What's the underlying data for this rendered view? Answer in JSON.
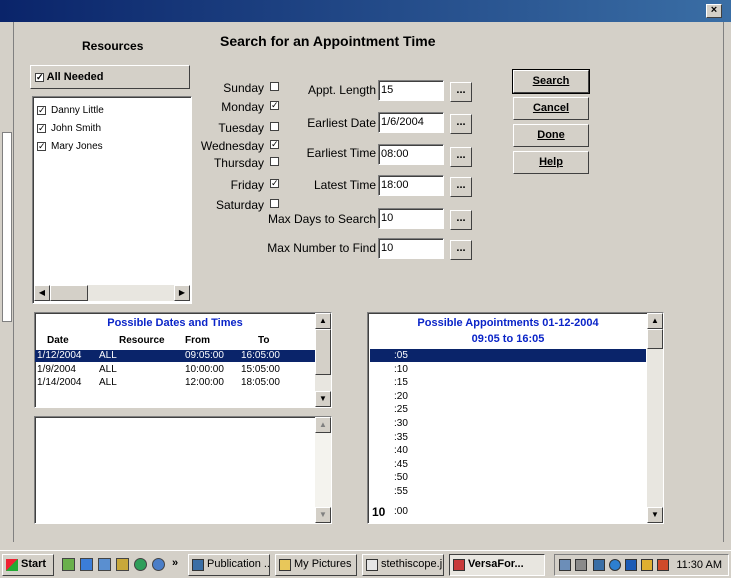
{
  "window": {
    "close_label": "×"
  },
  "resources": {
    "heading": "Resources",
    "all_needed": {
      "label": "All Needed",
      "checked": true
    },
    "items": [
      {
        "label": "Danny Little",
        "checked": true
      },
      {
        "label": "John Smith",
        "checked": true
      },
      {
        "label": "Mary Jones",
        "checked": true
      }
    ]
  },
  "dialog": {
    "title": "Search for an Appointment Time"
  },
  "days": [
    {
      "label": "Sunday",
      "checked": false
    },
    {
      "label": "Monday",
      "checked": true
    },
    {
      "label": "Tuesday",
      "checked": false
    },
    {
      "label": "Wednesday",
      "checked": true
    },
    {
      "label": "Thursday",
      "checked": false
    },
    {
      "label": "Friday",
      "checked": true
    },
    {
      "label": "Saturday",
      "checked": false
    }
  ],
  "fields": {
    "appt_length": {
      "label": "Appt. Length",
      "value": "15"
    },
    "earliest_date": {
      "label": "Earliest Date",
      "value": "1/6/2004"
    },
    "earliest_time": {
      "label": "Earliest Time",
      "value": "08:00"
    },
    "latest_time": {
      "label": "Latest Time",
      "value": "18:00"
    },
    "max_days": {
      "label": "Max Days to Search",
      "value": "10"
    },
    "max_number": {
      "label": "Max Number to Find",
      "value": "10"
    },
    "ellipsis": "..."
  },
  "buttons": {
    "search": "Search",
    "cancel": "Cancel",
    "done": "Done",
    "help": "Help"
  },
  "dates_panel": {
    "title": "Possible Dates and Times",
    "columns": {
      "date": "Date",
      "resource": "Resource",
      "from": "From",
      "to": "To"
    },
    "rows": [
      {
        "date": "1/12/2004",
        "resource": "ALL",
        "from": "09:05:00",
        "to": "16:05:00",
        "selected": true
      },
      {
        "date": "1/9/2004",
        "resource": "ALL",
        "from": "10:00:00",
        "to": "15:05:00",
        "selected": false
      },
      {
        "date": "1/14/2004",
        "resource": "ALL",
        "from": "12:00:00",
        "to": "18:05:00",
        "selected": false
      }
    ]
  },
  "appointments_panel": {
    "title": "Possible Appointments  01-12-2004",
    "subtitle": "09:05 to 16:05",
    "slots": [
      ":05",
      ":10",
      ":15",
      ":20",
      ":25",
      ":30",
      ":35",
      ":40",
      ":45",
      ":50",
      ":55"
    ],
    "hour_label": "10",
    "hour_slot": ":00"
  },
  "taskbar": {
    "start": "Start",
    "more": "»",
    "tasks": [
      "Publication ...",
      "My Pictures",
      "stethiscope.j...",
      "VersaFor..."
    ],
    "clock": "11:30 AM"
  }
}
